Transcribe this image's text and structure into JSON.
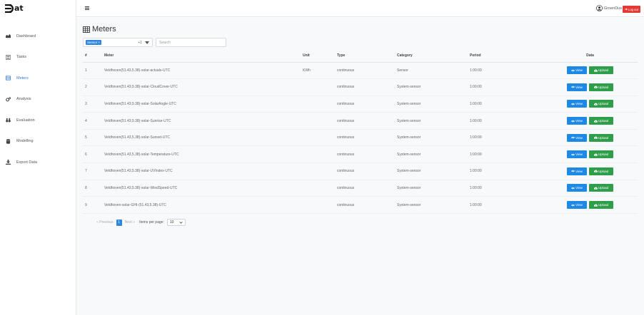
{
  "app": {
    "logo_text": "at"
  },
  "sidebar": {
    "items": [
      {
        "label": "Dashboard",
        "icon": "chart-area-icon",
        "active": false
      },
      {
        "label": "Tasks",
        "icon": "list-icon",
        "active": false
      },
      {
        "label": "Meters",
        "icon": "table-icon",
        "active": true
      },
      {
        "label": "Analysis",
        "icon": "cogs-icon",
        "active": false
      },
      {
        "label": "Evaluation",
        "icon": "binoculars-icon",
        "active": false
      },
      {
        "label": "Modelling",
        "icon": "database-icon",
        "active": false
      },
      {
        "label": "Export Data",
        "icon": "download-icon",
        "active": false
      }
    ]
  },
  "header": {
    "username": "GroenDus",
    "logout_label": "Log out"
  },
  "page": {
    "title": "Meters"
  },
  "filter": {
    "chip_label": "Sensor",
    "more_count": "+1",
    "search_placeholder": "Search"
  },
  "table": {
    "headers": {
      "index": "#",
      "meter": "Meter",
      "unit": "Unit",
      "type": "Type",
      "category": "Category",
      "period": "Period",
      "data": "Data"
    },
    "view_label": "View",
    "upload_label": "Upload",
    "rows": [
      {
        "index": "1",
        "meter": "Veldhoven(51.43,5.38)-solar-actuals-UTC",
        "unit": "KWh",
        "type": "continuous",
        "category": "Sensor",
        "period": "1:00:00"
      },
      {
        "index": "2",
        "meter": "Veldhoven(51.43,5.38)-solar-CloudCover-UTC",
        "unit": "",
        "type": "continuous",
        "category": "System-sensor",
        "period": "1:00:00"
      },
      {
        "index": "3",
        "meter": "Veldhoven(51.43,5.38)-solar-SolarAngle-UTC",
        "unit": "",
        "type": "continuous",
        "category": "System-sensor",
        "period": "1:00:00"
      },
      {
        "index": "4",
        "meter": "Veldhoven(51.43,5.38)-solar-Sunrise-UTC",
        "unit": "",
        "type": "continuous",
        "category": "System-sensor",
        "period": "1:00:00"
      },
      {
        "index": "5",
        "meter": "Veldhoven(51.43,5.38)-solar-Sunset-UTC",
        "unit": "",
        "type": "continuous",
        "category": "System-sensor",
        "period": "1:00:00"
      },
      {
        "index": "6",
        "meter": "Veldhoven(51.43,5.38)-solar-Temperature-UTC",
        "unit": "",
        "type": "continuous",
        "category": "System-sensor",
        "period": "1:00:00"
      },
      {
        "index": "7",
        "meter": "Veldhoven(51.43,5.38)-solar-UVIndex-UTC",
        "unit": "",
        "type": "continuous",
        "category": "System-sensor",
        "period": "1:00:00"
      },
      {
        "index": "8",
        "meter": "Veldhoven(51.43,5.38)-solar-WindSpeed-UTC",
        "unit": "",
        "type": "continuous",
        "category": "System-sensor",
        "period": "1:00:00"
      },
      {
        "index": "9",
        "meter": "Veldhoven-solar-GHI-(51.43,5.38)-UTC",
        "unit": "",
        "type": "continuous",
        "category": "System-sensor",
        "period": "1:00:00"
      }
    ]
  },
  "pagination": {
    "previous_label": "Previous",
    "current_page": "1",
    "next_label": "Next",
    "items_per_page_label": "Items per page:",
    "items_per_page_value": "10"
  },
  "colors": {
    "primary": "#2e86de",
    "view_button": "#1e88e5",
    "upload_button": "#2e9e4a",
    "logout_button": "#e53935"
  }
}
